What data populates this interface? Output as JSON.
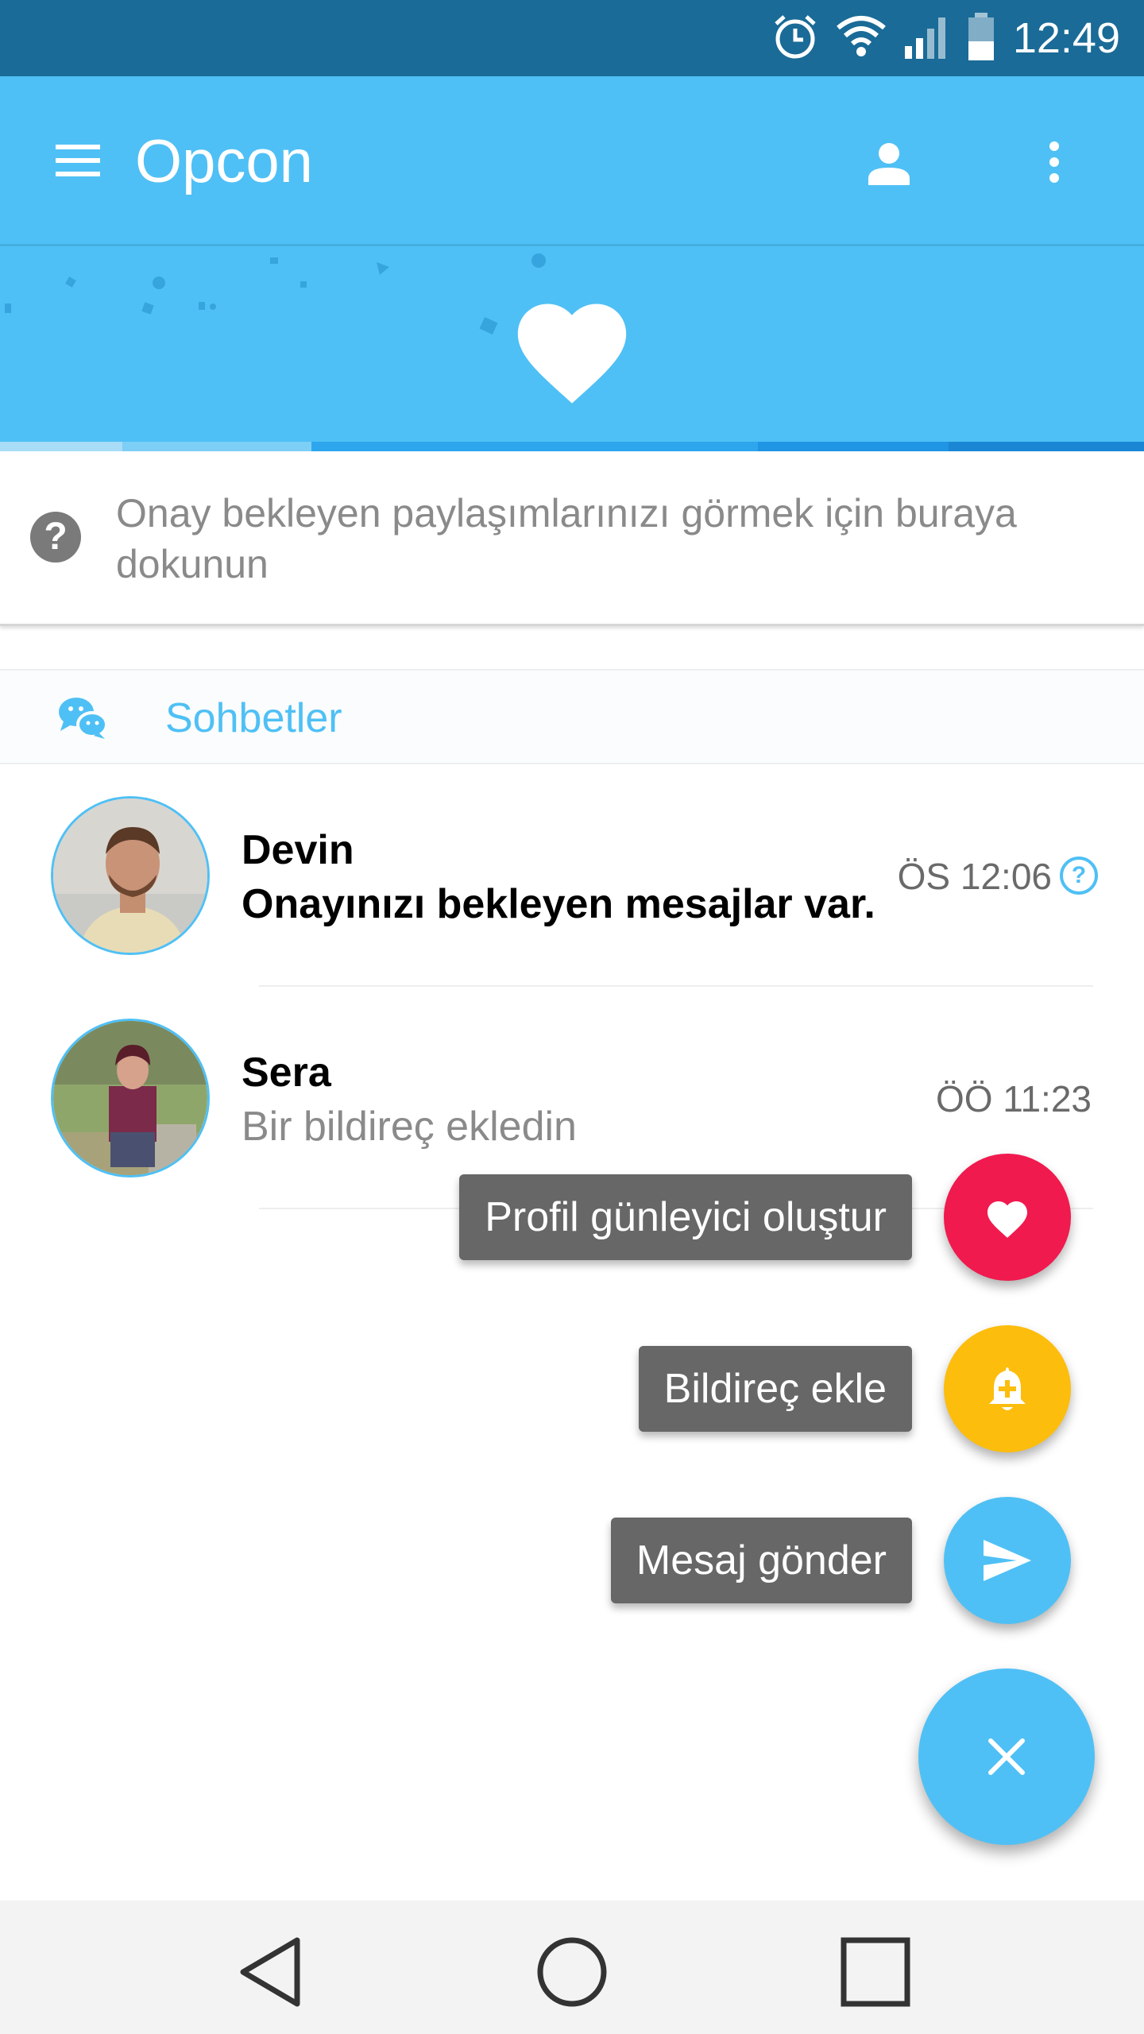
{
  "status_bar": {
    "time": "12:49",
    "icons": [
      "alarm-icon",
      "wifi-icon",
      "signal-icon",
      "battery-icon"
    ]
  },
  "app_bar": {
    "title": "Opcon",
    "icons": [
      "menu-icon",
      "person-icon",
      "more-vert-icon"
    ]
  },
  "hero": {
    "icon": "heart-icon"
  },
  "notice": {
    "icon": "help-icon",
    "icon_glyph": "?",
    "text": "Onay bekleyen paylaşımlarınızı görmek için buraya dokunun"
  },
  "section": {
    "icon": "chat-bubbles-icon",
    "title": "Sohbetler"
  },
  "conversations": [
    {
      "name": "Devin",
      "message": "Onayınızı bekleyen mesajlar var.",
      "time": "ÖS 12:06",
      "status_glyph": "?",
      "unread": true
    },
    {
      "name": "Sera",
      "message": "Bir bildireç ekledin",
      "time": "ÖÖ 11:23",
      "unread": false
    }
  ],
  "fab_menu": {
    "items": [
      {
        "label": "Profil günleyici oluştur",
        "icon": "heart-icon",
        "color": "#f01a4e"
      },
      {
        "label": "Bildireç ekle",
        "icon": "bell-add-icon",
        "color": "#fdbd0d"
      },
      {
        "label": "Mesaj gönder",
        "icon": "send-icon",
        "color": "#4fc0f5"
      }
    ],
    "main_icon": "close-icon"
  },
  "nav_bar": {
    "icons": [
      "back-icon",
      "home-icon",
      "recents-icon"
    ]
  },
  "colors": {
    "status_bar": "#1a6b97",
    "primary": "#4fc0f5",
    "heart_fab": "#f01a4e",
    "bell_fab": "#fdbd0d",
    "label_bg": "#676767"
  }
}
